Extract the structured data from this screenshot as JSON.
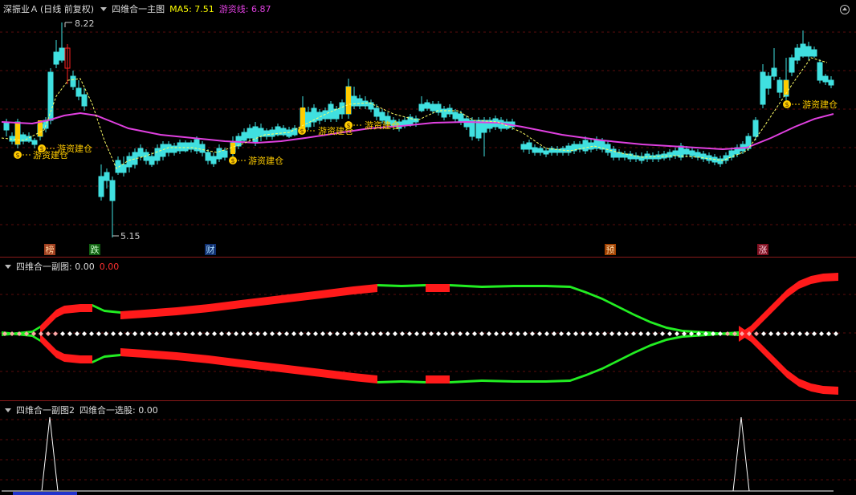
{
  "main_panel": {
    "stock_name": "深振业Ａ",
    "period": "(日线 前复权)",
    "indicator_name": "四维合一主图",
    "ma5_label": "MA5: 7.51",
    "yz_label": "游资线: 6.87",
    "high_label": "8.22",
    "low_label": "5.15",
    "signal_text": "游资建仓",
    "event_tags": [
      "榜",
      "跌",
      "财",
      "预",
      "涨"
    ],
    "colors": {
      "ma5": "#ffff00",
      "yz_line": "#e040e0",
      "up": "#ff2020",
      "down": "#40e0e0",
      "signal": "#ffcc00"
    }
  },
  "sub1": {
    "title": "四维合一副图",
    "value_white": ": 0.00",
    "value_red": "0.00"
  },
  "sub2": {
    "title": "四维合一副图2",
    "value_label": "四维合一选股: 0.00"
  }
}
